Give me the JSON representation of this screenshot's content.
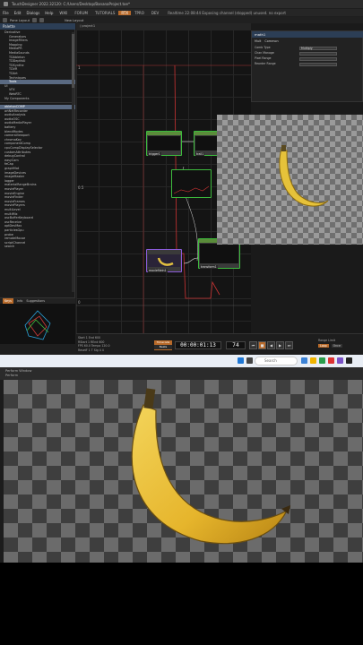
{
  "window": {
    "title": "TouchDesigner 2022.32120: C:/Users/Desktop/BananaProject.toe*",
    "menus": [
      "File",
      "Edit",
      "Dialogs",
      "Help"
    ],
    "tabs": [
      "WIKI",
      "FORUM",
      "TUTORIALS",
      "RTX",
      "TPRO",
      "DEV"
    ],
    "status": "Realtime 22:08:44 Exposing channel (stopped) unused. no export"
  },
  "toolbar": {
    "layout_label": "Pane Layout",
    "new_layout": "New Layout"
  },
  "palette": {
    "title": "Palette",
    "tree": [
      {
        "label": "Derivative",
        "indent": false
      },
      {
        "label": "Generators",
        "indent": true
      },
      {
        "label": "ImageFilters",
        "indent": true
      },
      {
        "label": "Mapping",
        "indent": true
      },
      {
        "label": "MediaPR",
        "indent": true
      },
      {
        "label": "MediaSounds",
        "indent": true
      },
      {
        "label": "TDAbleton",
        "indent": true
      },
      {
        "label": "TDDepthAI",
        "indent": true
      },
      {
        "label": "TDSynthe",
        "indent": true
      },
      {
        "label": "TDVR",
        "indent": true
      },
      {
        "label": "TDArt",
        "indent": true
      },
      {
        "label": "Techniques",
        "indent": true
      },
      {
        "label": "Tools",
        "indent": true,
        "selected": true
      },
      {
        "label": "UI",
        "indent": false
      },
      {
        "label": "VFX",
        "indent": true
      },
      {
        "label": "WebRTC",
        "indent": true
      },
      {
        "label": "My Components",
        "indent": false
      }
    ],
    "components": [
      "abletonCOMP",
      "artNetRecorder",
      "audioAnalysis",
      "audioOSC",
      "audioMediaPlayer",
      "battery",
      "blendModes",
      "cameraViewport",
      "chromaKey",
      "componentComp",
      "cpuCompDisplaySelector",
      "customAttributes",
      "debugControl",
      "easyCam",
      "feCap",
      "graphMat",
      "imageDevices",
      "imageMaster",
      "logger",
      "materialRangeBrains",
      "moviePlayer",
      "movieEngine",
      "movieFinder",
      "movieFrames",
      "moviePlayers",
      "multiLevel",
      "multiMix",
      "oscBufferKeyboard",
      "oscReceive",
      "optDevMax",
      "particlesGpu",
      "probe",
      "remoteMouse",
      "scriptChannel",
      "search"
    ]
  },
  "preview": {
    "tabs": [
      "Keys",
      "Info",
      "Suggestions"
    ]
  },
  "network": {
    "path": "/ project1",
    "nodes": [
      {
        "label": "trigger1"
      },
      {
        "label": "trail1"
      },
      {
        "label": "moviefilein1"
      },
      {
        "label": "transform1"
      }
    ],
    "axis_labels": [
      "1",
      "0.5",
      "0"
    ]
  },
  "params": {
    "title": "math1",
    "tabs": [
      "Mult",
      "Common"
    ],
    "rows": [
      {
        "label": "Comb Type",
        "value": "Multiply"
      },
      {
        "label": "Chan Manage",
        "value": ""
      },
      {
        "label": "Pixel Range",
        "value": ""
      },
      {
        "label": "Reorder Range",
        "value": ""
      }
    ]
  },
  "transport": {
    "info_lines": [
      "Start 1   End 600",
      "RStart 1  REnd 600",
      "FPS 60.0  Tempo 120.0",
      "ResetF 1  T Sig 4 4"
    ],
    "mode_label": "Timecode",
    "mode_sub": "Beats",
    "timecode": "00:00:01:13",
    "frame": "74",
    "range_label": "Range Limit",
    "range_opts": [
      "Loop",
      "Once"
    ]
  },
  "taskbar": {
    "search_placeholder": "Search"
  },
  "output_window": {
    "title": "Perform Window",
    "subtitle": "Perform"
  },
  "colors": {
    "accent": "#b86a2a",
    "node_green": "#3dbb3d",
    "palette_header": "#2c3e55"
  }
}
